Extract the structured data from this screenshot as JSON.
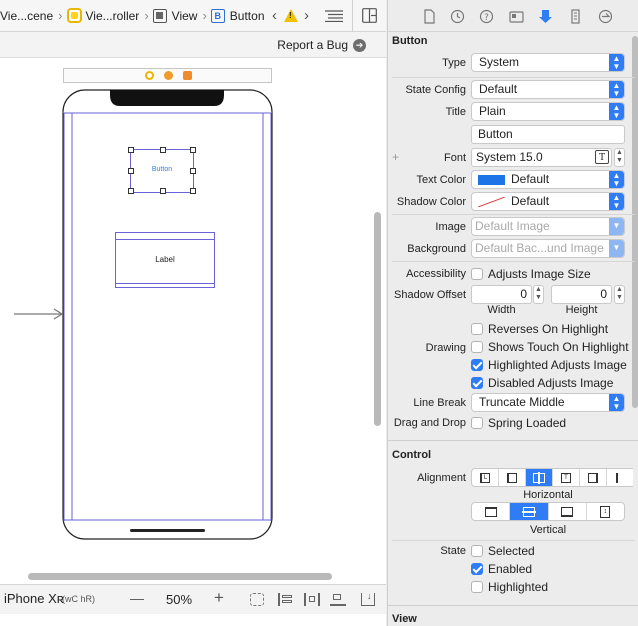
{
  "jumpbar": {
    "crumbs": [
      {
        "label": "Vie...cene",
        "icon": "storyboard-scene"
      },
      {
        "label": "Vie...roller",
        "icon": "view-controller-icon"
      },
      {
        "label": "View",
        "icon": "view-icon"
      },
      {
        "label": "Button",
        "icon": "button-b-icon",
        "glyph": "B"
      }
    ],
    "warning_glyph": "!"
  },
  "canvas": {
    "report_bug": "Report a Bug",
    "button_text": "Button",
    "label_text": "Label",
    "device": "iPhone Xʀ",
    "size_class": "(wC hR)",
    "zoom_minus": "—",
    "zoom": "50%",
    "zoom_plus": "+"
  },
  "inspector": {
    "button_section": "Button",
    "type_label": "Type",
    "type_value": "System",
    "state_config_label": "State Config",
    "state_config_value": "Default",
    "title_label": "Title",
    "title_value": "Plain",
    "title_text": "Button",
    "font_label": "Font",
    "font_value": "System 15.0",
    "text_color_label": "Text Color",
    "text_color_value": "Default",
    "text_color_swatch": "#1d74e6",
    "shadow_color_label": "Shadow Color",
    "shadow_color_value": "Default",
    "image_label": "Image",
    "image_placeholder": "Default Image",
    "background_label": "Background",
    "background_placeholder": "Default Bac...und Image",
    "accessibility_label": "Accessibility",
    "adjusts_image_size": "Adjusts Image Size",
    "shadow_offset_label": "Shadow Offset",
    "shadow_width": "0",
    "shadow_height": "0",
    "width_label": "Width",
    "height_label": "Height",
    "reverses_on_highlight": "Reverses On Highlight",
    "drawing_label": "Drawing",
    "shows_touch": "Shows Touch On Highlight",
    "highlighted_adjusts": "Highlighted Adjusts Image",
    "disabled_adjusts": "Disabled Adjusts Image",
    "line_break_label": "Line Break",
    "line_break_value": "Truncate Middle",
    "drag_drop_label": "Drag and Drop",
    "spring_loaded": "Spring Loaded",
    "control_section": "Control",
    "alignment_label": "Alignment",
    "horizontal_label": "Horizontal",
    "vertical_label": "Vertical",
    "state_label": "State",
    "selected": "Selected",
    "enabled": "Enabled",
    "highlighted": "Highlighted",
    "view_section": "View",
    "checks": {
      "adjusts_image_size": false,
      "reverses_on_highlight": false,
      "shows_touch": false,
      "highlighted_adjusts": true,
      "disabled_adjusts": true,
      "spring_loaded": false,
      "selected": false,
      "enabled": true,
      "highlighted": false
    },
    "accent": "#2f7df6"
  }
}
